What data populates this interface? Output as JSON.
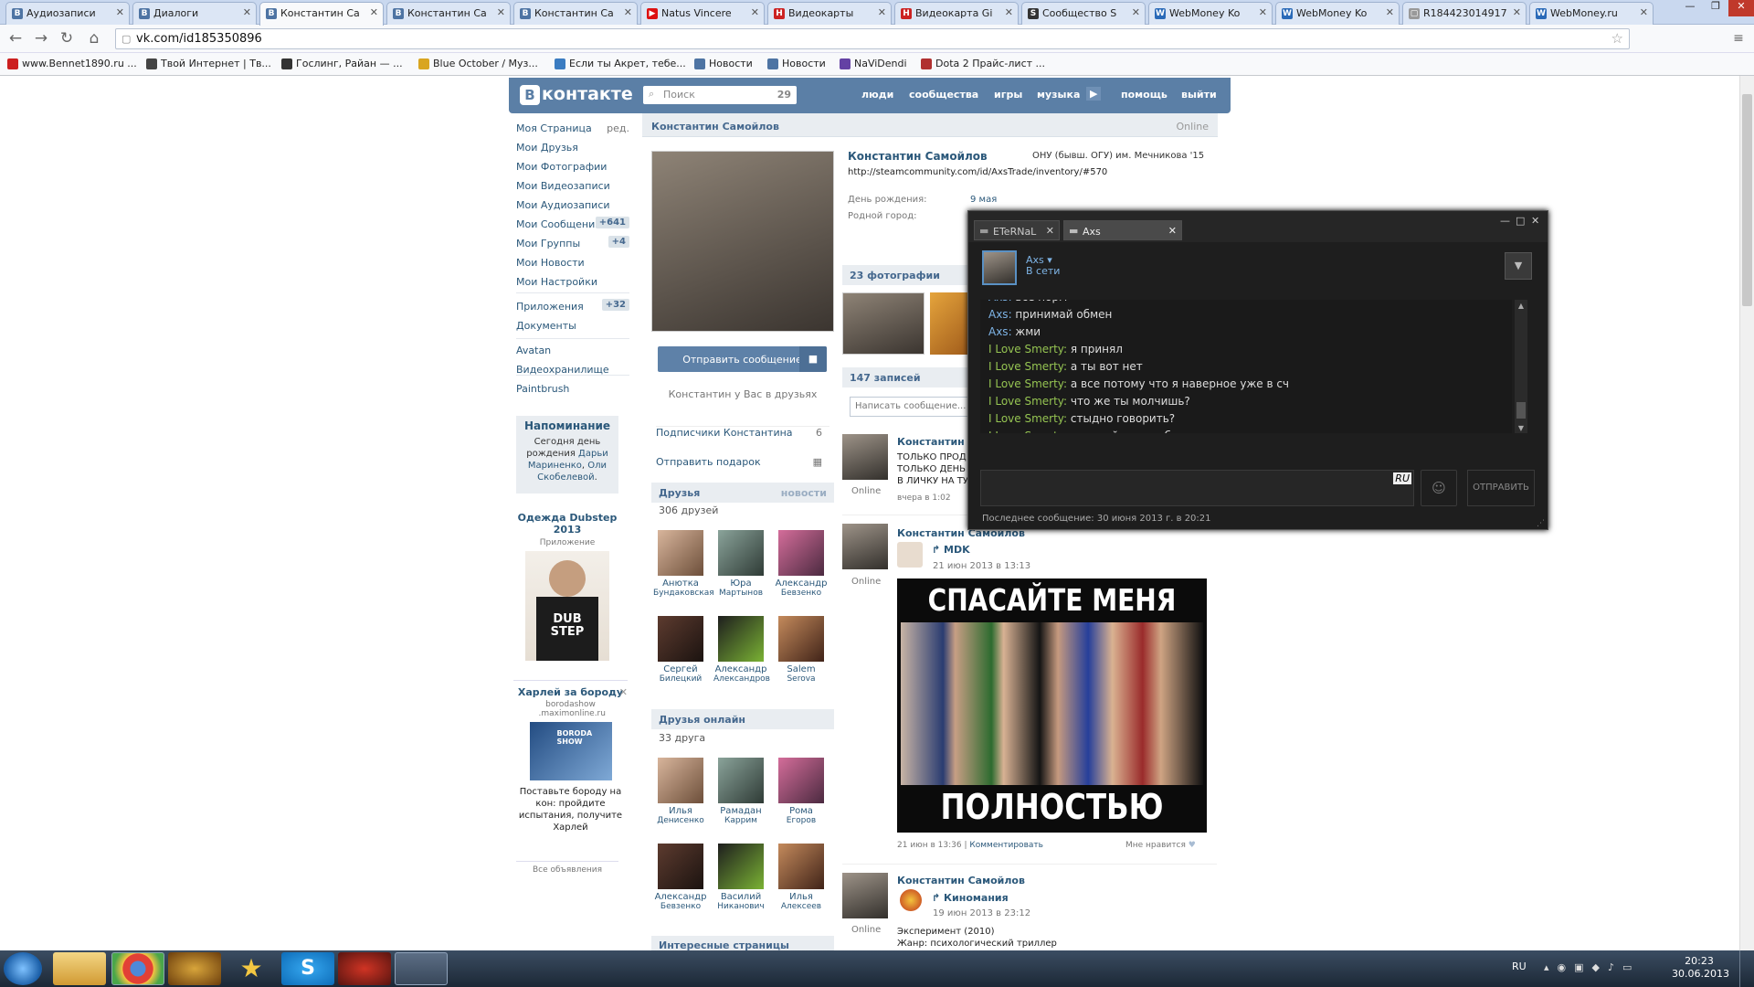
{
  "browser": {
    "tabs": [
      {
        "label": "Аудиозаписи",
        "icon": "vk"
      },
      {
        "label": "Диалоги",
        "icon": "vk"
      },
      {
        "label": "Константин Са",
        "icon": "vk",
        "active": true
      },
      {
        "label": "Константин Са",
        "icon": "vk"
      },
      {
        "label": "Константин Са",
        "icon": "vk"
      },
      {
        "label": "Natus Vincere",
        "icon": "youtube"
      },
      {
        "label": "Видеокарты",
        "icon": "hotline"
      },
      {
        "label": "Видеокарта Gi",
        "icon": "hotline"
      },
      {
        "label": "Сообщество S",
        "icon": "steam"
      },
      {
        "label": "WebMoney Ko",
        "icon": "webmoney"
      },
      {
        "label": "WebMoney Ko",
        "icon": "webmoney"
      },
      {
        "label": "R184423014917",
        "icon": "page"
      },
      {
        "label": "WebMoney.ru",
        "icon": "webmoney"
      }
    ],
    "url": "vk.com/id185350896",
    "bookmarks": [
      {
        "label": "www.Bennet1890.ru ...",
        "color": "#cc1f1f"
      },
      {
        "label": "Твой Интернет | Тв...",
        "color": "#444"
      },
      {
        "label": "Гослинг, Райан — ...",
        "color": "#333"
      },
      {
        "label": "Blue October / Муз...",
        "color": "#d9a520"
      },
      {
        "label": "Если ты Акрет, тебе...",
        "color": "#3a7cc1"
      },
      {
        "label": "Новости",
        "color": "#4e74a3"
      },
      {
        "label": "Новости",
        "color": "#4e74a3"
      },
      {
        "label": "NaViDendi",
        "color": "#6441a4"
      },
      {
        "label": "Dota 2 Прайс-лист ...",
        "color": "#b03030"
      }
    ]
  },
  "vk": {
    "logo": "контакте",
    "search_placeholder": "Поиск",
    "search_count": "29",
    "header_links": [
      "люди",
      "сообщества",
      "игры",
      "музыка",
      "помощь",
      "выйти"
    ],
    "left_menu": [
      {
        "label": "Моя Страница",
        "extra": "ред."
      },
      {
        "label": "Мои Друзья"
      },
      {
        "label": "Мои Фотографии"
      },
      {
        "label": "Мои Видеозаписи"
      },
      {
        "label": "Мои Аудиозаписи"
      },
      {
        "label": "Мои Сообщения",
        "count": "+641"
      },
      {
        "label": "Мои Группы",
        "count": "+4"
      },
      {
        "label": "Мои Новости"
      },
      {
        "label": "Мои Настройки"
      },
      {
        "label": "Приложения",
        "count": "+32"
      },
      {
        "label": "Документы"
      },
      {
        "label": "Avatan"
      },
      {
        "label": "Видеохранилище"
      },
      {
        "label": "Paintbrush"
      }
    ],
    "reminder": {
      "title": "Напоминание",
      "text1": "Сегодня",
      "text2": "день рождения",
      "name1": "Дарьи Мариненко",
      "sep": ",",
      "name2": "Оли Скобелевой",
      "end": "."
    },
    "ads": [
      {
        "title": "Одежда Dubstep 2013",
        "sub": "Приложение",
        "img_text": "DUB STEP"
      },
      {
        "title": "Харлей за бороду",
        "sub": "borodashow .maximonline.ru",
        "img_text": "BORODA SHOW",
        "text": "Поставьте бороду на кон: пройдите испытания, получите Харлей"
      }
    ],
    "all_ads": "Все объявления",
    "profile": {
      "name": "Константин Самойлов",
      "status": "Online",
      "fullname": "Константин Самойлов",
      "edu": "ОНУ (бывш. ОГУ) им. Мечникова '15",
      "link": "http://steamcommunity.com/id/AxsTrade/inventory/#570",
      "bday_label": "День рождения:",
      "bday": "9 мая",
      "city_label": "Родной город:",
      "send_msg": "Отправить сообщение",
      "in_friends": "Константин у Вас в друзьях",
      "subscribers": "Подписчики Константина",
      "subscribers_count": "6",
      "gift": "Отправить подарок"
    },
    "friends": {
      "title": "Друзья",
      "news": "новости",
      "count": "306 друзей",
      "list": [
        {
          "n1": "Анютка",
          "n2": "Бундаковская"
        },
        {
          "n1": "Юра",
          "n2": "Мартынов"
        },
        {
          "n1": "Александр",
          "n2": "Бевзенко"
        },
        {
          "n1": "Сергей",
          "n2": "Билецкий"
        },
        {
          "n1": "Александр",
          "n2": "Александров"
        },
        {
          "n1": "Salem",
          "n2": "Serova"
        }
      ]
    },
    "friends_online": {
      "title": "Друзья онлайн",
      "count": "33 друга",
      "list": [
        {
          "n1": "Илья",
          "n2": "Денисенко"
        },
        {
          "n1": "Рамадан",
          "n2": "Каррим"
        },
        {
          "n1": "Рома",
          "n2": "Егоров"
        },
        {
          "n1": "Александр",
          "n2": "Бевзенко"
        },
        {
          "n1": "Василий",
          "n2": "Никанович"
        },
        {
          "n1": "Илья",
          "n2": "Алексеев"
        }
      ]
    },
    "interesting": "Интересные страницы",
    "photos_title": "23 фотографии",
    "wall_title": "147 записей",
    "wall_placeholder": "Написать сообщение...",
    "posts": [
      {
        "author": "Константин С",
        "lines": [
          "ТОЛЬКО ПРОД",
          "ТОЛЬКО ДЕНЬ",
          "В ЛИЧКУ НА ТУ"
        ],
        "status": "Online",
        "time": "вчера в 1:02"
      },
      {
        "author": "Константин Самойлов",
        "repost": "MDK",
        "repost_time": "21 июн 2013 в 13:13",
        "status": "Online",
        "img_top": "СПАСАЙТЕ МЕНЯ",
        "img_bottom": "ПОЛНОСТЬЮ",
        "time": "21 июн в 13:36",
        "comment": "Комментировать",
        "like": "Мне нравится"
      },
      {
        "author": "Константин Самойлов",
        "repost": "Киномания",
        "repost_time": "19 июн 2013 в 23:12",
        "status": "Online",
        "lines": [
          "Эксперимент (2010)",
          "Жанр: психологический триллер"
        ]
      }
    ]
  },
  "chat": {
    "tabs": [
      "ETeRNaL",
      "Axs"
    ],
    "user": "Axs",
    "user_status": "В сети",
    "messages": [
      {
        "from": "Axs",
        "text": "все норм",
        "who": 1
      },
      {
        "from": "Axs",
        "text": "принимай обмен",
        "who": 1
      },
      {
        "from": "Axs",
        "text": "жми",
        "who": 1
      },
      {
        "from": "I Love Smerty",
        "text": "я принял",
        "who": 2
      },
      {
        "from": "I Love Smerty",
        "text": "а ты вот нет",
        "who": 2
      },
      {
        "from": "I Love Smerty",
        "text": "а все потому что я наверное уже в сч",
        "who": 2
      },
      {
        "from": "I Love Smerty",
        "text": "что же ты молчишь?",
        "who": 2
      },
      {
        "from": "I Love Smerty",
        "text": "стыдно говорить?",
        "who": 2
      },
      {
        "from": "I Love Smerty",
        "text": "признайся хотя бы",
        "who": 2
      }
    ],
    "lang": "RU",
    "send": "ОТПРАВИТЬ",
    "last_msg": "Последнее сообщение: 30 июня 2013 г. в 20:21"
  },
  "taskbar": {
    "lang": "RU",
    "time": "20:23",
    "date": "30.06.2013"
  }
}
